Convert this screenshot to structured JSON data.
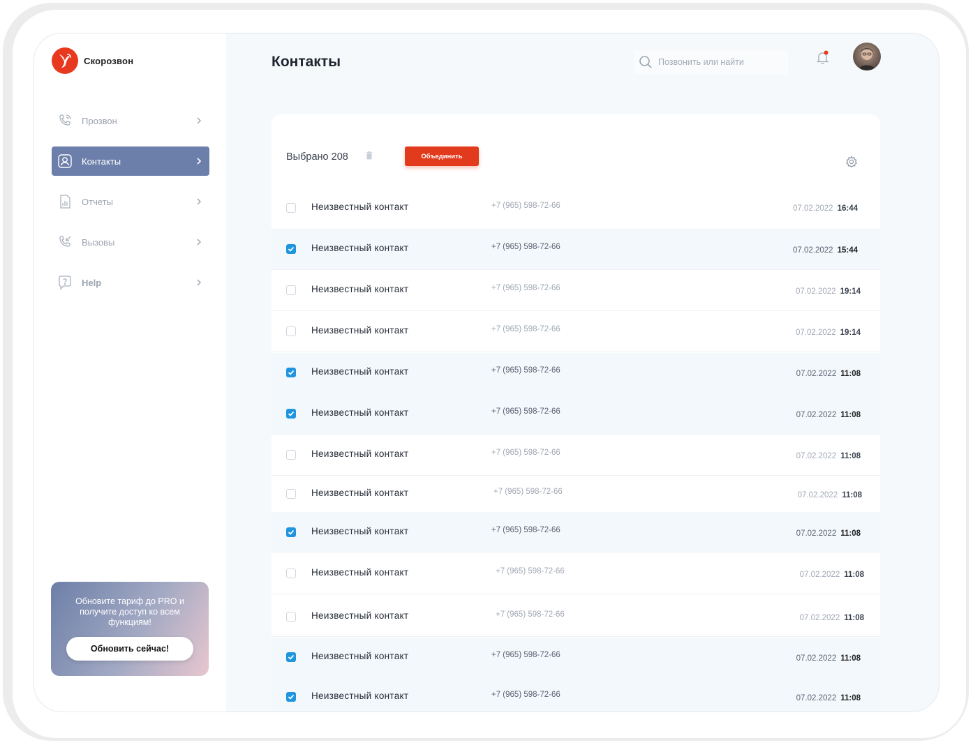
{
  "app": {
    "name": "Скорозвон"
  },
  "sidebar": {
    "items": [
      {
        "label": "Прозвон",
        "icon": "phone-outgoing-icon"
      },
      {
        "label": "Контакты",
        "icon": "contact-icon"
      },
      {
        "label": "Отчеты",
        "icon": "report-icon"
      },
      {
        "label": "Вызовы",
        "icon": "phone-incoming-icon"
      },
      {
        "label": "Help",
        "icon": "help-icon"
      }
    ],
    "active_index": 1
  },
  "promo": {
    "text": "Обновите тариф до PRO и получите доступ ко всем функциям!",
    "button": "Обновить сейчас!"
  },
  "header": {
    "title": "Контакты",
    "search_placeholder": "Позвонить или найти"
  },
  "toolbar": {
    "selected_label": "Выбрано 208",
    "merge_label": "Объединить"
  },
  "colors": {
    "accent": "#e23a1d",
    "sidebar_active": "#6c7faa",
    "checkbox": "#1f95e0"
  },
  "contacts": [
    {
      "name": "Неизвестный контакт",
      "phone": "+7 (965) 598-72-66",
      "date": "07.02.2022",
      "time": "16:44",
      "checked": false
    },
    {
      "name": "Неизвестный контакт",
      "phone": "+7 (965) 598-72-66",
      "date": "07.02.2022",
      "time": "15:44",
      "checked": true
    },
    {
      "name": "Неизвестный контакт",
      "phone": "+7 (965) 598-72-66",
      "date": "07.02.2022",
      "time": "19:14",
      "checked": false
    },
    {
      "name": "Неизвестный контакт",
      "phone": "+7 (965) 598-72-66",
      "date": "07.02.2022",
      "time": "19:14",
      "checked": false
    },
    {
      "name": "Неизвестный контакт",
      "phone": "+7 (965) 598-72-66",
      "date": "07.02.2022",
      "time": "11:08",
      "checked": true
    },
    {
      "name": "Неизвестный контакт",
      "phone": "+7 (965) 598-72-66",
      "date": "07.02.2022",
      "time": "11:08",
      "checked": true
    },
    {
      "name": "Неизвестный контакт",
      "phone": "+7 (965) 598-72-66",
      "date": "07.02.2022",
      "time": "11:08",
      "checked": false
    },
    {
      "name": "Неизвестный контакт",
      "phone": "+7 (965) 598-72-66",
      "date": "07.02.2022",
      "time": "11:08",
      "checked": false
    },
    {
      "name": "Неизвестный контакт",
      "phone": "+7 (965) 598-72-66",
      "date": "07.02.2022",
      "time": "11:08",
      "checked": true
    },
    {
      "name": "Неизвестный контакт",
      "phone": "+7 (965) 598-72-66",
      "date": "07.02.2022",
      "time": "11:08",
      "checked": false
    },
    {
      "name": "Неизвестный контакт",
      "phone": "+7 (965) 598-72-66",
      "date": "07.02.2022",
      "time": "11:08",
      "checked": false
    },
    {
      "name": "Неизвестный контакт",
      "phone": "+7 (965) 598-72-66",
      "date": "07.02.2022",
      "time": "11:08",
      "checked": true
    },
    {
      "name": "Неизвестный контакт",
      "phone": "+7 (965) 598-72-66",
      "date": "07.02.2022",
      "time": "11:08",
      "checked": true
    }
  ]
}
